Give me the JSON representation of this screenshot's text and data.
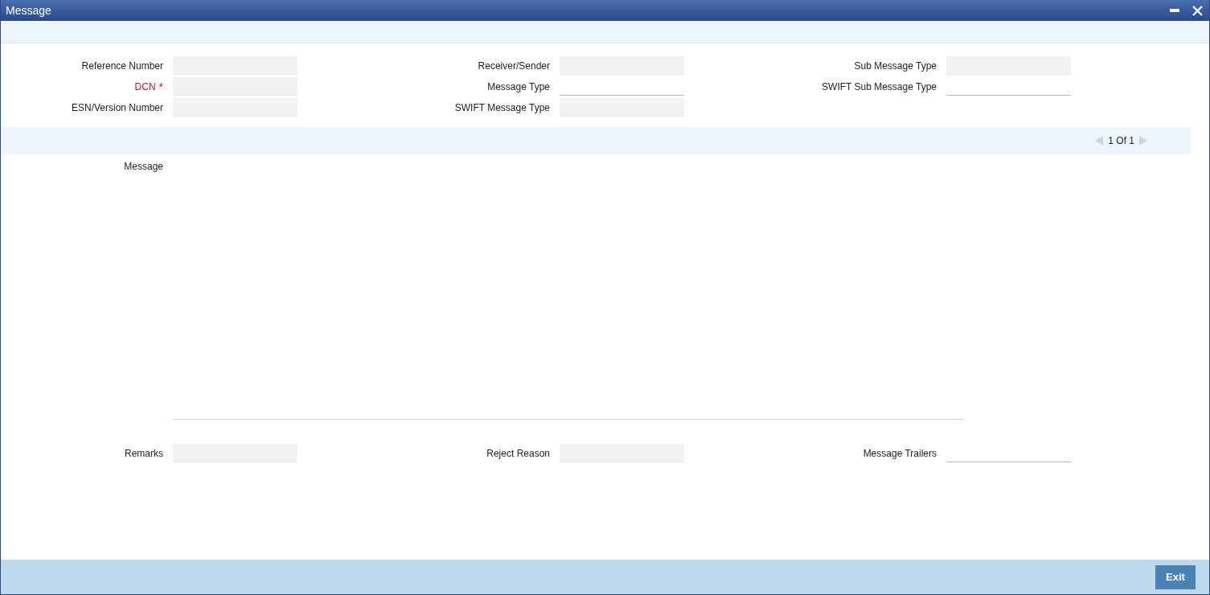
{
  "window": {
    "title": "Message"
  },
  "header_fields": [
    [
      {
        "label": "Reference Number",
        "disabled": true
      },
      {
        "label": "DCN",
        "required_mark": "*",
        "disabled": true
      },
      {
        "label": "ESN/Version Number",
        "disabled": true
      }
    ],
    [
      {
        "label": "Receiver/Sender",
        "disabled": true
      },
      {
        "label": "Message Type",
        "disabled": false
      },
      {
        "label": "SWIFT Message Type",
        "disabled": true
      }
    ],
    [
      {
        "label": "Sub Message Type",
        "disabled": true
      },
      {
        "label": "SWIFT Sub Message Type",
        "disabled": false
      }
    ]
  ],
  "pager": {
    "text": "1 Of 1"
  },
  "message": {
    "label": "Message"
  },
  "footer_fields": [
    {
      "label": "Remarks",
      "disabled": true
    },
    {
      "label": "Reject Reason",
      "disabled": true
    },
    {
      "label": "Message Trailers",
      "disabled": false
    }
  ],
  "buttons": [
    "Exit"
  ]
}
